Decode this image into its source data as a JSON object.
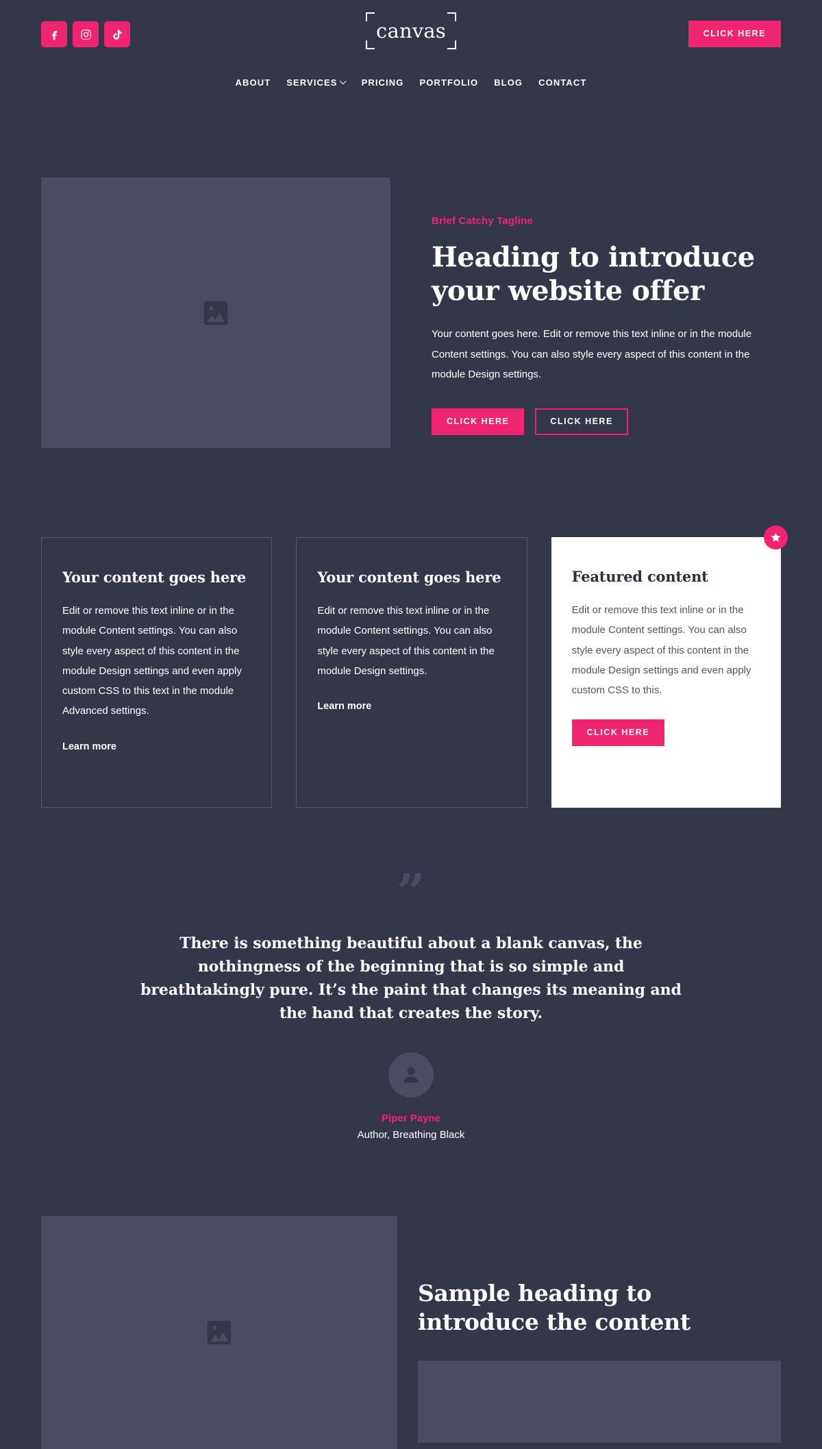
{
  "theme": {
    "bg": "#343747",
    "accent": "#f0256f",
    "placeholder": "#4a4d60",
    "card_border": "#555869",
    "white": "#ffffff"
  },
  "header": {
    "logo_text": "canvas",
    "social": [
      {
        "name": "facebook-icon",
        "label": "Facebook"
      },
      {
        "name": "instagram-icon",
        "label": "Instagram"
      },
      {
        "name": "tiktok-icon",
        "label": "TikTok"
      }
    ],
    "cta_label": "CLICK HERE",
    "nav": [
      {
        "label": "ABOUT",
        "has_dropdown": false
      },
      {
        "label": "SERVICES",
        "has_dropdown": true
      },
      {
        "label": "PRICING",
        "has_dropdown": false
      },
      {
        "label": "PORTFOLIO",
        "has_dropdown": false
      },
      {
        "label": "BLOG",
        "has_dropdown": false
      },
      {
        "label": "CONTACT",
        "has_dropdown": false
      }
    ]
  },
  "hero": {
    "image_icon": "image-placeholder-icon",
    "tagline": "Brief Catchy Tagline",
    "heading": "Heading to introduce your website offer",
    "body": "Your content goes here. Edit or remove this text inline or in the module Content settings. You can also style every aspect of this content in the module Design settings.",
    "primary_btn": "CLICK HERE",
    "secondary_btn": "CLICK HERE"
  },
  "cards": [
    {
      "title": "Your content goes here",
      "body": "Edit or remove this text inline or in the module Content settings. You can also style every aspect of this content in the module Design settings and even apply custom CSS to this text in the module Advanced settings.",
      "link": "Learn more",
      "featured": false
    },
    {
      "title": "Your content goes here",
      "body": "Edit or remove this text inline or in the module Content settings. You can also style every aspect of this content in the module Design settings.",
      "link": "Learn more",
      "featured": false
    },
    {
      "title": "Featured content",
      "body": "Edit or remove this text inline or in the module Content settings. You can also style every aspect of this content in the module Design settings and even apply custom CSS to this.",
      "button": "CLICK HERE",
      "badge_icon": "star-icon",
      "featured": true
    }
  ],
  "testimonial": {
    "quote_mark": "”",
    "quote": "There is something beautiful about a blank canvas, the nothingness of the beginning that is so simple and breathtakingly pure. It’s the paint that changes its meaning and the hand that creates the story.",
    "avatar_icon": "user-avatar-icon",
    "author_name": "Piper Payne",
    "author_role": "Author, Breathing Black"
  },
  "bottom": {
    "image_icon": "image-placeholder-icon",
    "heading": "Sample heading to introduce the content"
  }
}
